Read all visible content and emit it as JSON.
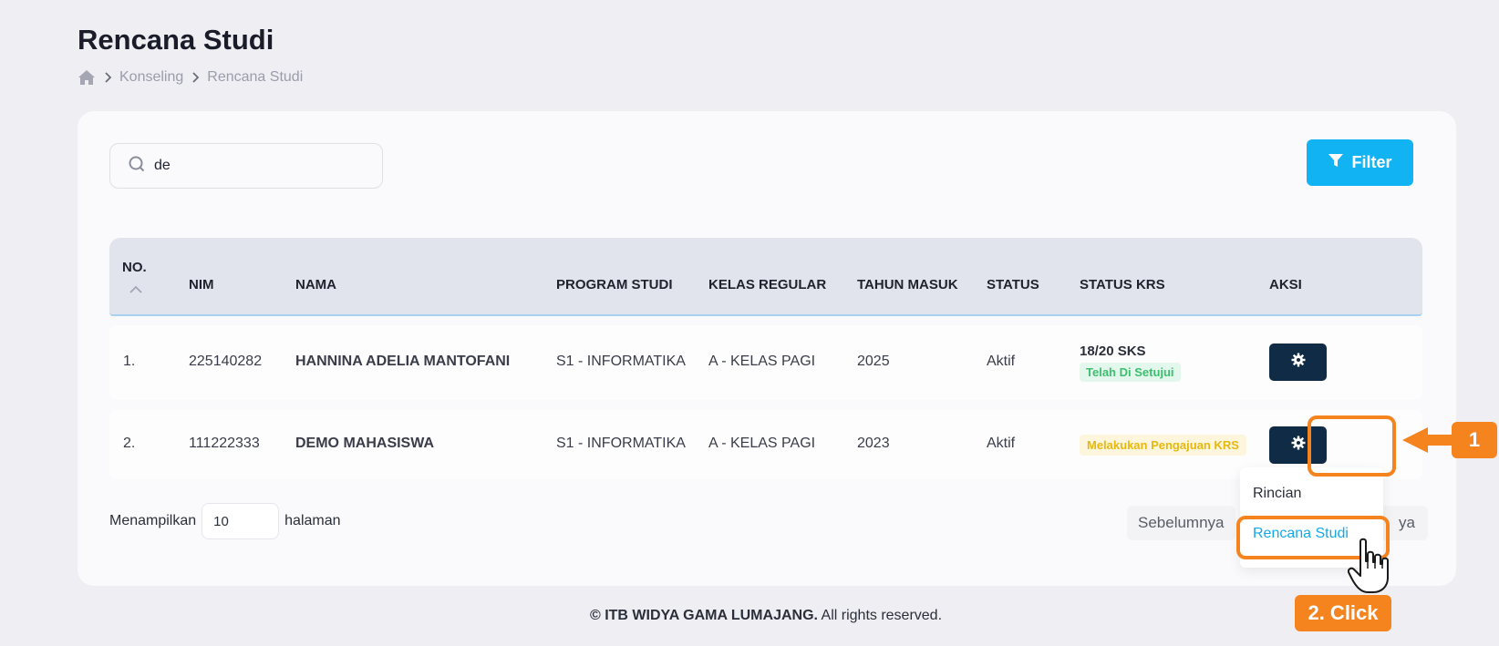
{
  "page": {
    "title": "Rencana Studi",
    "breadcrumb": [
      "Konseling",
      "Rencana Studi"
    ]
  },
  "search": {
    "value": "de"
  },
  "filter": {
    "label": "Filter"
  },
  "table": {
    "columns": [
      "NO.",
      "NIM",
      "NAMA",
      "PROGRAM STUDI",
      "KELAS REGULAR",
      "TAHUN MASUK",
      "STATUS",
      "STATUS KRS",
      "AKSI"
    ],
    "rows": [
      {
        "no": "1.",
        "nim": "225140282",
        "nama": "HANNINA ADELIA MANTOFANI",
        "prodi": "S1 - INFORMATIKA",
        "kelas": "A - KELAS PAGI",
        "tahun": "2025",
        "status": "Aktif",
        "krs_sks": "18/20 SKS",
        "krs_status": "Telah Di Setujui"
      },
      {
        "no": "2.",
        "nim": "111222333",
        "nama": "DEMO MAHASISWA",
        "prodi": "S1 - INFORMATIKA",
        "kelas": "A - KELAS PAGI",
        "tahun": "2023",
        "status": "Aktif",
        "krs_sks": "",
        "krs_status": "Melakukan Pengajuan KRS"
      }
    ]
  },
  "footer": {
    "show_label": "Menampilkan",
    "per_page": "10",
    "page_label": "halaman",
    "prev_label": "Sebelumnya",
    "next_label_visible": "ya"
  },
  "dropdown": {
    "items": [
      "Rincian",
      "Rencana Studi"
    ]
  },
  "annotations": {
    "step1": "1",
    "step2": "2. Click"
  },
  "copyright": {
    "org": "© ITB WIDYA GAMA LUMAJANG.",
    "text": " All rights reserved."
  },
  "colors": {
    "accent": "#12b3f2",
    "action_button": "#0f2b45",
    "highlight": "#f5841f",
    "badge_green": "#3dbf6f",
    "badge_yellow": "#e8b80f"
  }
}
